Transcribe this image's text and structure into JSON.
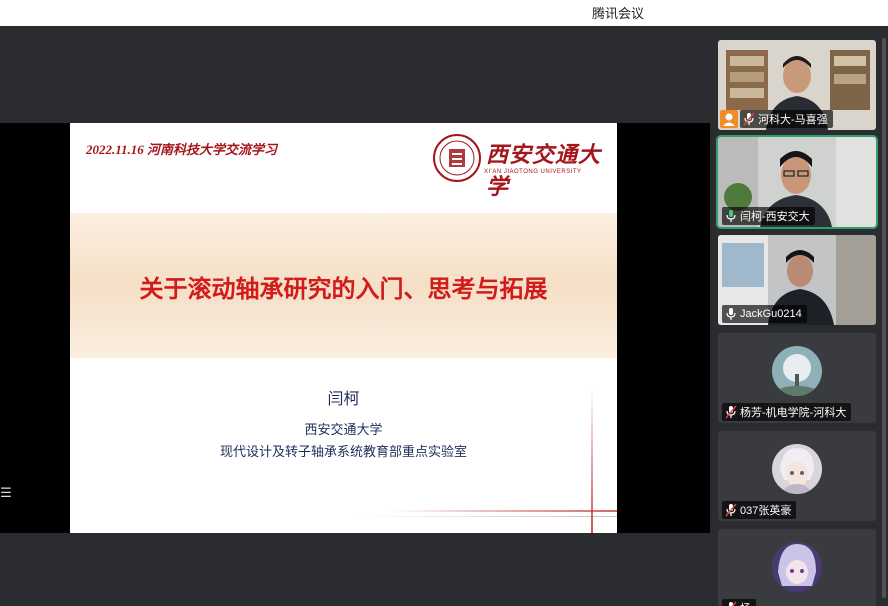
{
  "window": {
    "title": "腾讯会议"
  },
  "slide": {
    "header_left": "2022.11.16  河南科技大学交流学习",
    "university_cn": "西安交通大学",
    "university_en": "XI'AN JIAOTONG UNIVERSITY",
    "title": "关于滚动轴承研究的入门、思考与拓展",
    "author": "闫柯",
    "affiliation_1": "西安交通大学",
    "affiliation_2": "现代设计及转子轴承系统教育部重点实验室"
  },
  "participants": [
    {
      "name": "河科大-马喜强",
      "host": true,
      "active": false,
      "type": "video",
      "scene": "bookshelf"
    },
    {
      "name": "闫柯-西安交大",
      "host": false,
      "active": true,
      "type": "video",
      "scene": "office-glasses"
    },
    {
      "name": "JackGu0214",
      "host": false,
      "active": false,
      "type": "video",
      "scene": "office-dark"
    },
    {
      "name": "杨芳-机电学院-河科大",
      "host": false,
      "active": false,
      "type": "avatar",
      "avatar": "tree-avatar"
    },
    {
      "name": "037张英豪",
      "host": false,
      "active": false,
      "type": "avatar",
      "avatar": "anime-avatar"
    },
    {
      "name": "杨",
      "host": false,
      "active": false,
      "type": "avatar",
      "avatar": "purple-avatar"
    }
  ],
  "colors": {
    "accent_red": "#a5161c",
    "title_red": "#d21b1b",
    "active_green": "#2fa06b"
  }
}
